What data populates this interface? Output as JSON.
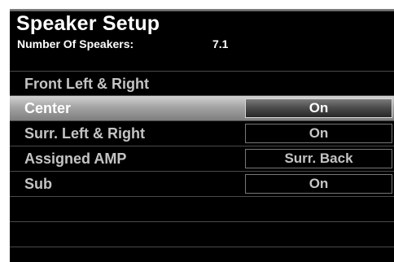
{
  "header": {
    "title": "Speaker Setup",
    "speakers_label": "Number Of Speakers:",
    "speakers_value": "7.1"
  },
  "menu": {
    "selected_index": 1,
    "items": [
      {
        "label": "Front Left & Right",
        "value": ""
      },
      {
        "label": "Center",
        "value": "On"
      },
      {
        "label": "Surr. Left & Right",
        "value": "On"
      },
      {
        "label": "Assigned AMP",
        "value": "Surr. Back"
      },
      {
        "label": "Sub",
        "value": "On"
      },
      {
        "label": "",
        "value": ""
      },
      {
        "label": "",
        "value": ""
      }
    ]
  },
  "colors": {
    "background": "#000000",
    "text": "#ffffff",
    "dim_text": "#c4c4c4",
    "highlight": "#a4a4a4"
  }
}
